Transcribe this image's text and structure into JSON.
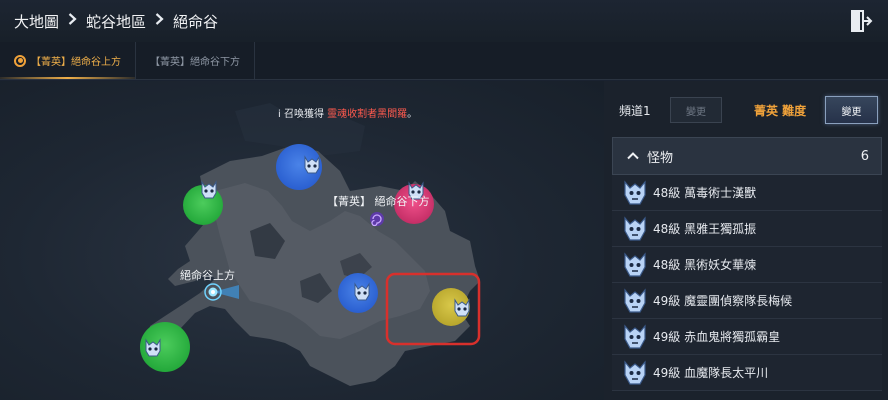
{
  "breadcrumb": {
    "items": [
      "大地圖",
      "蛇谷地區",
      "絕命谷"
    ]
  },
  "tabs": [
    {
      "label": "【菁英】絕命谷上方",
      "active": true
    },
    {
      "label": "【菁英】絕命谷下方",
      "active": false
    }
  ],
  "notice": {
    "prefix": "i 召喚獲得 ",
    "highlight": "靈魂收割者黑閻羅",
    "suffix": "。"
  },
  "map": {
    "label_lower": "【菁英】 絕命谷下方",
    "label_upper": "絕命谷上方"
  },
  "panel": {
    "channel_label": "頻道1",
    "channel_change_label": "變更",
    "difficulty_label": "菁英 難度",
    "difficulty_change_label": "變更",
    "monsters_header": "怪物",
    "monsters_count": "6",
    "monsters": [
      {
        "text": "48級 萬毒術士漢獸"
      },
      {
        "text": "48級 黑雅王獨孤振"
      },
      {
        "text": "48級 黑術妖女華煉"
      },
      {
        "text": "49級 魔靈團偵察隊長梅候"
      },
      {
        "text": "49級 赤血鬼將獨孤霸皇"
      },
      {
        "text": "49級 血魔隊長太平川"
      }
    ]
  },
  "colors": {
    "accent": "#f0a23a",
    "notice_highlight": "#ff5a4e",
    "highlight_box": "#d8302c"
  }
}
